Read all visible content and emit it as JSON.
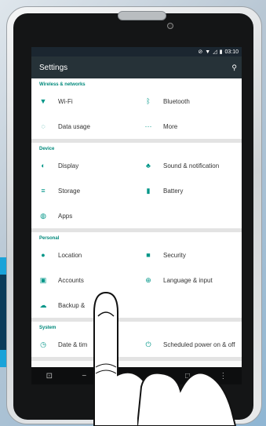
{
  "status": {
    "time": "03:10"
  },
  "header": {
    "title": "Settings"
  },
  "sections": [
    {
      "title": "Wireless & networks",
      "rows": [
        [
          {
            "label": "Wi-Fi",
            "icon": "wifi-icon"
          },
          {
            "label": "Bluetooth",
            "icon": "bluetooth-icon"
          }
        ],
        [
          {
            "label": "Data usage",
            "icon": "data-usage-icon"
          },
          {
            "label": "More",
            "icon": "more-icon"
          }
        ]
      ]
    },
    {
      "title": "Device",
      "rows": [
        [
          {
            "label": "Display",
            "icon": "display-icon"
          },
          {
            "label": "Sound & notification",
            "icon": "bell-icon"
          }
        ],
        [
          {
            "label": "Storage",
            "icon": "storage-icon"
          },
          {
            "label": "Battery",
            "icon": "battery-icon"
          }
        ],
        [
          {
            "label": "Apps",
            "icon": "android-icon"
          },
          {
            "label": "",
            "icon": ""
          }
        ]
      ]
    },
    {
      "title": "Personal",
      "rows": [
        [
          {
            "label": "Location",
            "icon": "location-icon"
          },
          {
            "label": "Security",
            "icon": "lock-icon"
          }
        ],
        [
          {
            "label": "Accounts",
            "icon": "accounts-icon"
          },
          {
            "label": "Language & input",
            "icon": "globe-icon"
          }
        ],
        [
          {
            "label": "Backup &",
            "icon": "cloud-icon"
          },
          {
            "label": "",
            "icon": ""
          }
        ]
      ]
    },
    {
      "title": "System",
      "rows": [
        [
          {
            "label": "Date & tim",
            "icon": "clock-icon"
          },
          {
            "label": "Scheduled power on & off",
            "icon": "power-icon"
          }
        ]
      ]
    }
  ],
  "colors": {
    "accent": "#009688",
    "appbar": "#263238",
    "bracket": "#1aa3d9"
  }
}
